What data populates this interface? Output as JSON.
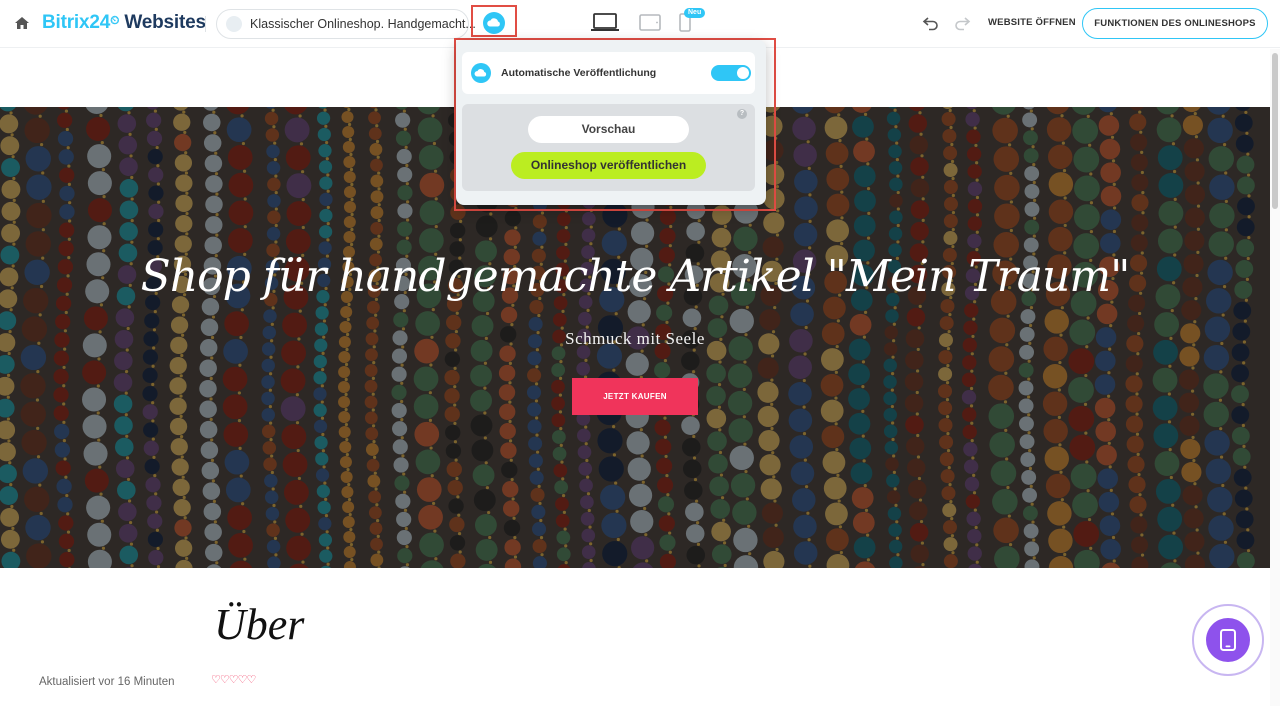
{
  "topbar": {
    "logo_brand": "Bitrix24",
    "logo_clock": "⏲",
    "logo_product": "Websites",
    "site_name": "Klassischer Onlineshop. Handgemacht...",
    "new_badge": "Neu",
    "open_site_label": "WEBSITE ÖFFNEN",
    "shop_features_label": "FUNKTIONEN DES ONLINESHOPS"
  },
  "popup": {
    "auto_publish_label": "Automatische Veröffentlichung",
    "auto_publish_enabled": true,
    "help_glyph": "?",
    "preview_label": "Vorschau",
    "publish_label": "Onlineshop veröffentlichen"
  },
  "hero": {
    "title": "Shop für handgemachte Artikel \"Mein Traum\"",
    "subtitle": "Schmuck mit Seele",
    "buy_button": "JETZT KAUFEN"
  },
  "about": {
    "title": "Über",
    "updated": "Aktualisiert vor 16 Minuten",
    "hearts": "♡♡♡♡♡"
  },
  "colors": {
    "accent": "#2fc6f6",
    "publish_green": "#bbed21",
    "buy_red": "#f0345b",
    "highlight_red": "#e14d44",
    "fab_purple": "#8e52ec"
  }
}
